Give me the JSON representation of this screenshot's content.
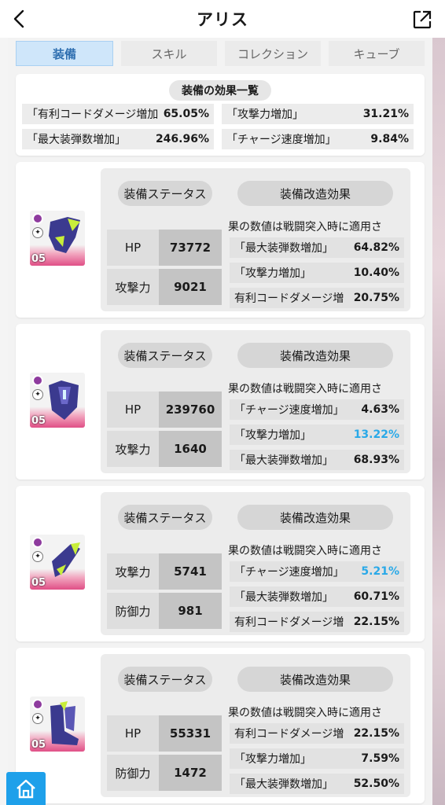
{
  "header": {
    "title": "アリス"
  },
  "tabs": [
    {
      "label": "装備",
      "active": true
    },
    {
      "label": "スキル",
      "active": false
    },
    {
      "label": "コレクション",
      "active": false
    },
    {
      "label": "キューブ",
      "active": false
    }
  ],
  "summary": {
    "title": "装備の効果一覧",
    "items": [
      {
        "label": "「有利コードダメージ増加",
        "value": "65.05%"
      },
      {
        "label": "「攻撃力増加」",
        "value": "31.21%"
      },
      {
        "label": "「最大装弾数増加」",
        "value": "246.96%"
      },
      {
        "label": "「チャージ速度増加」",
        "value": "9.84%"
      }
    ]
  },
  "cards": [
    {
      "level": "05",
      "status_label": "装備ステータス",
      "mod_label": "装備改造効果",
      "stats": [
        {
          "label": "HP",
          "value": "73772"
        },
        {
          "label": "攻撃力",
          "value": "9021"
        }
      ],
      "note": "果の数値は戦闘突入時に適用さ",
      "mods": [
        {
          "label": "「最大装弾数増加」",
          "value": "64.82%",
          "highlight": false
        },
        {
          "label": "「攻撃力増加」",
          "value": "10.40%",
          "highlight": false
        },
        {
          "label": "有利コードダメージ増",
          "value": "20.75%",
          "highlight": false
        }
      ]
    },
    {
      "level": "05",
      "status_label": "装備ステータス",
      "mod_label": "装備改造効果",
      "stats": [
        {
          "label": "HP",
          "value": "239760"
        },
        {
          "label": "攻撃力",
          "value": "1640"
        }
      ],
      "note": "果の数値は戦闘突入時に適用さ",
      "mods": [
        {
          "label": "「チャージ速度増加」",
          "value": "4.63%",
          "highlight": false
        },
        {
          "label": "「攻撃力増加」",
          "value": "13.22%",
          "highlight": true
        },
        {
          "label": "「最大装弾数増加」",
          "value": "68.93%",
          "highlight": false
        }
      ]
    },
    {
      "level": "05",
      "status_label": "装備ステータス",
      "mod_label": "装備改造効果",
      "stats": [
        {
          "label": "攻撃力",
          "value": "5741"
        },
        {
          "label": "防御力",
          "value": "981"
        }
      ],
      "note": "果の数値は戦闘突入時に適用さ",
      "mods": [
        {
          "label": "「チャージ速度増加」",
          "value": "5.21%",
          "highlight": true
        },
        {
          "label": "「最大装弾数増加」",
          "value": "60.71%",
          "highlight": false
        },
        {
          "label": "有利コードダメージ増",
          "value": "22.15%",
          "highlight": false
        }
      ]
    },
    {
      "level": "05",
      "status_label": "装備ステータス",
      "mod_label": "装備改造効果",
      "stats": [
        {
          "label": "HP",
          "value": "55331"
        },
        {
          "label": "防御力",
          "value": "1472"
        }
      ],
      "note": "果の数値は戦闘突入時に適用さ",
      "mods": [
        {
          "label": "有利コードダメージ増",
          "value": "22.15%",
          "highlight": false
        },
        {
          "label": "「攻撃力増加」",
          "value": "7.59%",
          "highlight": false
        },
        {
          "label": "「最大装弾数増加」",
          "value": "52.50%",
          "highlight": false
        }
      ]
    }
  ],
  "colors": {
    "highlight": "#29a9e8",
    "home": "#1ea0ea",
    "active_tab": "#cfe6fa"
  },
  "icons": {
    "back": "chevron-left-icon",
    "external": "open-external-icon",
    "home": "home-icon"
  }
}
